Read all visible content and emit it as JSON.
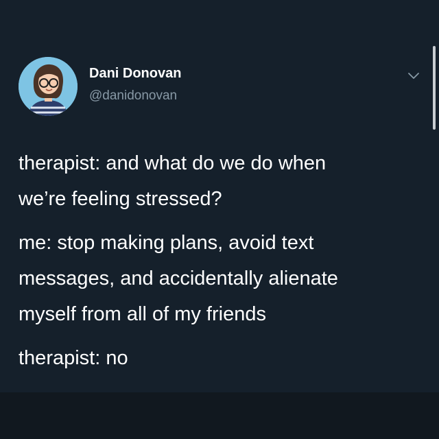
{
  "colors": {
    "background": "#15202b",
    "text_primary": "#ffffff",
    "text_secondary": "#8899a6",
    "avatar_background": "#7ec4e4"
  },
  "author": {
    "display_name": "Dani Donovan",
    "handle": "@danidonovan",
    "avatar_icon": "illustrated-avatar-woman-glasses"
  },
  "menu": {
    "icon": "chevron-down-icon"
  },
  "tweet": {
    "paragraphs": [
      {
        "lines": [
          "therapist: and what do we do when",
          "we’re feeling stressed?"
        ]
      },
      {
        "lines": [
          "me: stop making plans, avoid text",
          "messages, and accidentally alienate",
          "myself from all of my friends"
        ]
      },
      {
        "lines": [
          "therapist: no"
        ]
      }
    ]
  }
}
